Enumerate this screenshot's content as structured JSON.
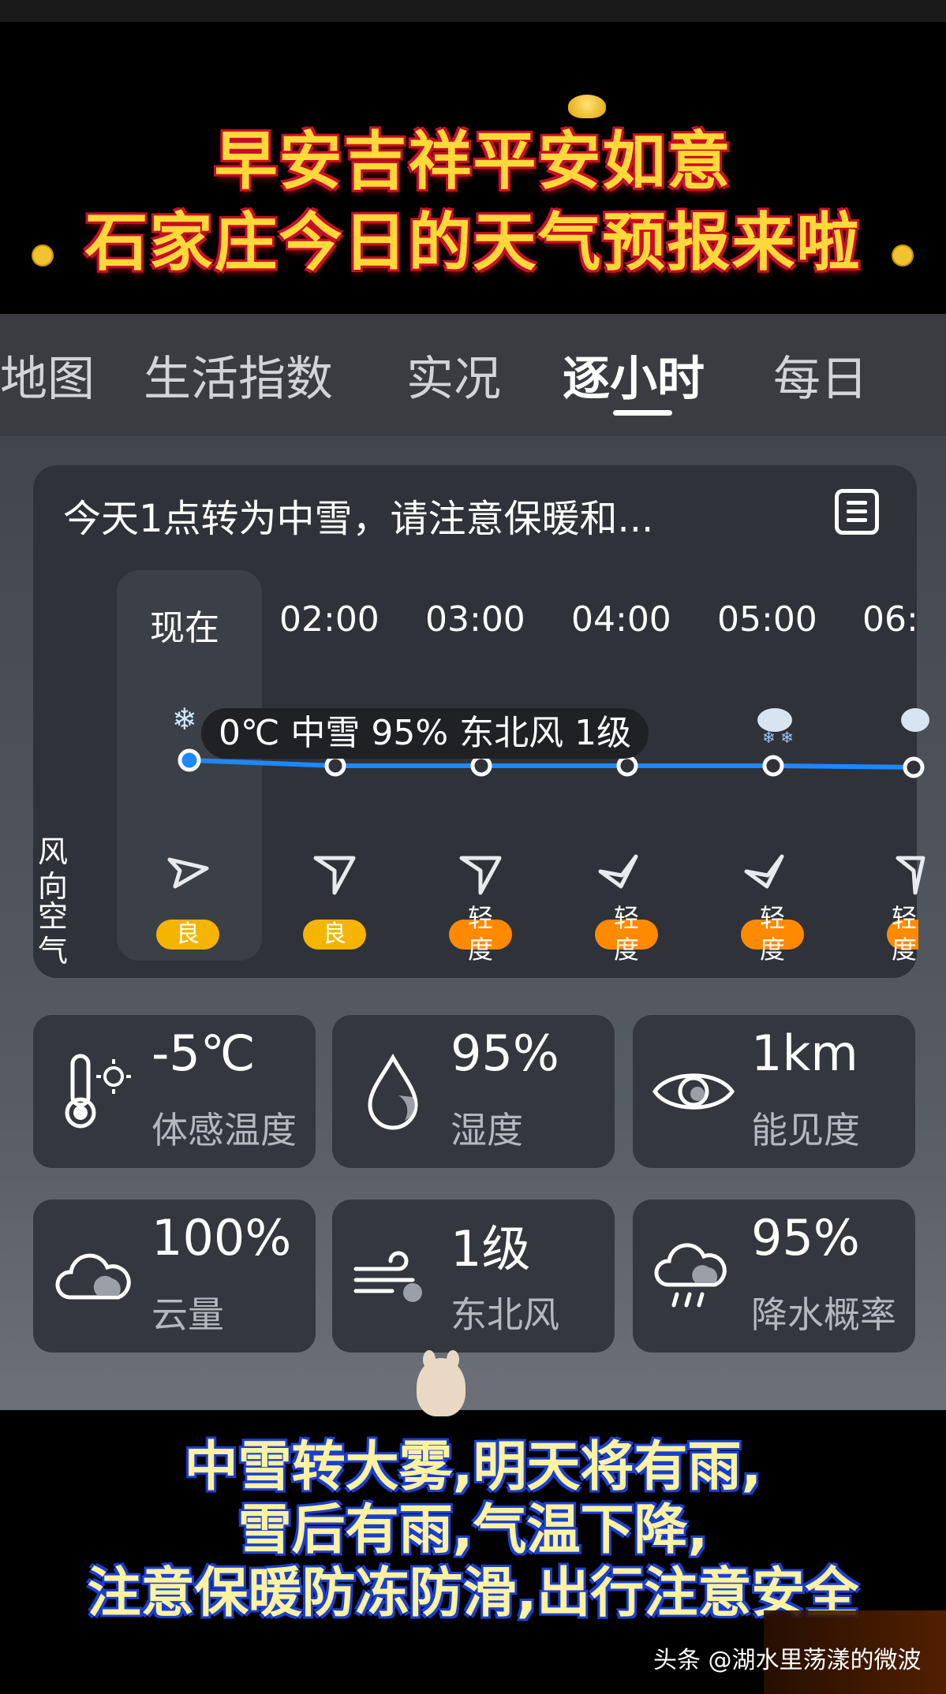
{
  "banner": {
    "line1": "早安吉祥平安如意",
    "line2": "石家庄今日的天气预报来啦"
  },
  "tabs": [
    {
      "label": "地图",
      "active": false
    },
    {
      "label": "生活指数",
      "active": false
    },
    {
      "label": "实况",
      "active": false
    },
    {
      "label": "逐小时",
      "active": true
    },
    {
      "label": "每日",
      "active": false
    }
  ],
  "hourly": {
    "alert": "今天1点转为中雪，请注意保暖和...",
    "times": [
      "现在",
      "02:00",
      "03:00",
      "04:00",
      "05:00",
      "06:"
    ],
    "tooltip": "0℃ 中雪 95% 东北风 1级",
    "row_labels": {
      "wind": "风向",
      "air": "空气"
    },
    "aqi": [
      "良",
      "良",
      "轻度",
      "轻度",
      "轻度",
      "轻度"
    ],
    "wind_dirs": [
      "northeast",
      "south",
      "south",
      "northwest",
      "northwest",
      "south"
    ],
    "icons": [
      "snow-icon",
      "snow-icon",
      "snow-icon",
      "snow-icon",
      "snow-cloud-icon",
      "snow-cloud-icon"
    ]
  },
  "stats": [
    {
      "value": "-5℃",
      "label": "体感温度",
      "icon": "thermometer-sun-icon"
    },
    {
      "value": "95%",
      "label": "湿度",
      "icon": "droplet-icon"
    },
    {
      "value": "1km",
      "label": "能见度",
      "icon": "eye-icon"
    },
    {
      "value": "100%",
      "label": "云量",
      "icon": "cloud-icon"
    },
    {
      "value": "1级",
      "label": "东北风",
      "icon": "wind-icon"
    },
    {
      "value": "95%",
      "label": "降水概率",
      "icon": "rain-cloud-icon"
    }
  ],
  "captions": {
    "line1": "中雪转大雾,明天将有雨,",
    "line2": "雪后有雨,气温下降,",
    "line3": "注意保暖防冻防滑,出行注意安全"
  },
  "watermark": "头条 @湖水里荡漾的微波",
  "colors": {
    "line": "#1e88ff",
    "aqi_good": "#f5b400",
    "aqi_light": "#ff8a00"
  }
}
